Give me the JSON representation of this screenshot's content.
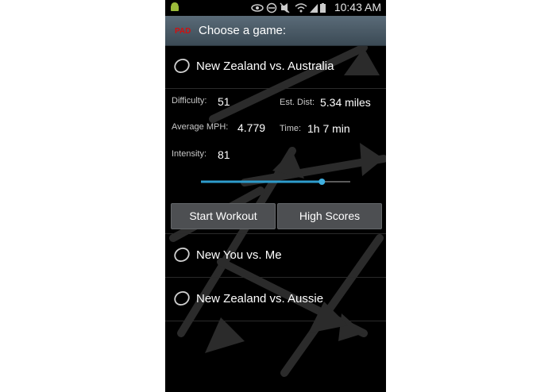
{
  "status_bar": {
    "time": "10:43 AM",
    "icons": [
      "android-icon",
      "eye-icon",
      "nfc-icon",
      "mute-icon",
      "wifi-icon",
      "signal-icon",
      "battery-icon"
    ]
  },
  "title_bar": {
    "logo_text": "PAD",
    "title": "Choose a game:"
  },
  "games": [
    {
      "label": "New Zealand vs. Australia",
      "selected": false
    },
    {
      "label": "New You vs. Me",
      "selected": false
    },
    {
      "label": "New Zealand vs. Aussie",
      "selected": false
    }
  ],
  "details": {
    "difficulty_label": "Difficulty:",
    "difficulty_value": "51",
    "est_dist_label": "Est. Dist:",
    "est_dist_value": "5.34 miles",
    "avg_mph_label": "Average MPH:",
    "avg_mph_value": "4.779",
    "time_label": "Time:",
    "time_value": "1h 7 min",
    "intensity_label": "Intensity:",
    "intensity_value": "81"
  },
  "slider": {
    "value_percent": 81
  },
  "buttons": {
    "start_workout": "Start Workout",
    "high_scores": "High Scores"
  },
  "colors": {
    "accent": "#2e9ccc",
    "logo": "#d01010",
    "background": "#000000",
    "title_bar": "#4b5b67"
  }
}
